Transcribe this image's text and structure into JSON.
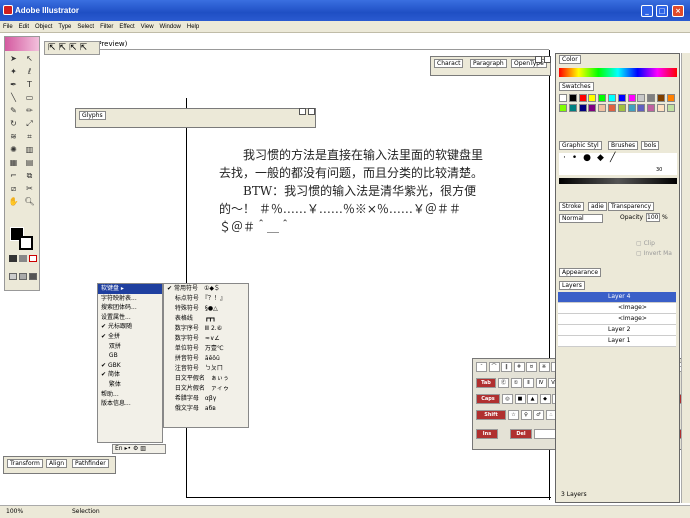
{
  "app": {
    "title": "Adobe Illustrator"
  },
  "window_buttons": {
    "minimize": "_",
    "maximize": "□",
    "close": "×"
  },
  "menu": [
    "File",
    "Edit",
    "Object",
    "Type",
    "Select",
    "Filter",
    "Effect",
    "View",
    "Window",
    "Help"
  ],
  "document": {
    "tab_suffix": "/Preview)"
  },
  "glyphs_panel": {
    "tab": "Glyphs"
  },
  "character_panel": {
    "tabs": [
      "Charact",
      "Paragraph",
      "OpenType"
    ]
  },
  "text_block": {
    "p1": "我习惯的方法是直接在输入法里面的软键盘里去找，一般的都没有问题，而且分类的比较清楚。",
    "p2": "BTW：我习惯的输入法是清华紫光，很方便的～！ ＃％……￥……％※×％……￥＠＃＃＄＠＃＾＿＾"
  },
  "ime_menu": {
    "items": [
      "软键盘",
      "字符映射表...",
      "搜索团体码...",
      "设置属性...",
      "光标跟随",
      "全拼",
      "双拼",
      "GB",
      "GBK",
      "简体",
      "繁体",
      "帮助...",
      "版本信息..."
    ],
    "checked": [
      "光标跟随",
      "全拼",
      "GBK",
      "简体"
    ],
    "highlighted": "软键盘"
  },
  "ime_submenu": {
    "items": [
      "常用符号　①◆＄",
      "标点符号　『？！』",
      "特殊符号　§●△",
      "表格线　　┏┳┓",
      "数字序号　Ⅲ 2.⑥",
      "数字符号　≈∨∠",
      "单位符号　万壹℃",
      "拼音符号　āēōū",
      "注音符号　ㄅㄆㄇ",
      "日文平假名　ぁぃぅ",
      "日文片假名　ァィゥ",
      "希腊字母　αβγ",
      "俄文字母　абв"
    ],
    "checked": "常用符号　①◆＄"
  },
  "ime_status": {
    "text": "En ▸• ⚙ ▥"
  },
  "color_panel": {
    "tab": "Color"
  },
  "swatches_panel": {
    "tab": "Swatches",
    "colors": [
      "#ffffff",
      "#000000",
      "#ff0000",
      "#ffff00",
      "#00ff00",
      "#00ffff",
      "#0000ff",
      "#ff00ff",
      "#c8c8c8",
      "#808080",
      "#804000",
      "#ff8000",
      "#80ff00",
      "#008080",
      "#000080",
      "#800080",
      "#f0c0a0",
      "#e06040",
      "#a0c040",
      "#40a0c0",
      "#6060c0",
      "#c060a0",
      "#ffe0c0",
      "#c0e0a0"
    ]
  },
  "graphic_styles_panel": {
    "tabs": [
      "Graphic Styl",
      "Brushes",
      "bols"
    ],
    "brush_size": "30"
  },
  "stroke_panel": {
    "tabs": [
      "Stroke",
      "adie",
      "Transparency"
    ],
    "mode": "Normal",
    "opacity_label": "Opacity",
    "opacity_value": "100",
    "opacity_unit": "%",
    "clip": "Clip",
    "invert": "Invert Ma"
  },
  "appearance_panel": {
    "tab": "Appearance"
  },
  "layers_panel": {
    "tab": "Layers",
    "rows": [
      {
        "name": "Layer 4",
        "selected": true
      },
      {
        "name": "<Image>",
        "selected": false
      },
      {
        "name": "<Image>",
        "selected": false
      },
      {
        "name": "Layer 2",
        "selected": false
      },
      {
        "name": "Layer 1",
        "selected": false
      }
    ],
    "count": "3 Layers"
  },
  "keyboard": {
    "row1": [
      "ˉ",
      "⌒",
      "‖",
      "＃",
      "¤",
      "※",
      "〔",
      "〕",
      "『",
      "』",
      "「",
      "」",
      "〈",
      "〉",
      "＜",
      "＞",
      "－"
    ],
    "row2_label": "Tab",
    "row2": [
      "Ⓔ",
      "①",
      "Ⅱ",
      "Ⅳ",
      "Ⅵ",
      "Ⅷ",
      "Ⅹ",
      "【",
      "】",
      "〖",
      "〗",
      "《",
      "》"
    ],
    "row3_label": "Caps",
    "row3": [
      "◎",
      "■",
      "▲",
      "◆",
      "●",
      "★",
      "○",
      "☆",
      "◇",
      "□",
      "△"
    ],
    "row4_label": "Shift",
    "row4": [
      "☆",
      "♀",
      "♂",
      "∴",
      "∵",
      "§",
      "№",
      "÷",
      "·",
      "？"
    ],
    "enter_label": "Enter",
    "ins_label": "Ins",
    "del_label": "Del",
    "esc_label": "Esc"
  },
  "transform_panel": {
    "tabs": [
      "Transform",
      "Align",
      "Pathfinder"
    ]
  },
  "status": {
    "zoom": "100%",
    "tool": "Selection"
  }
}
